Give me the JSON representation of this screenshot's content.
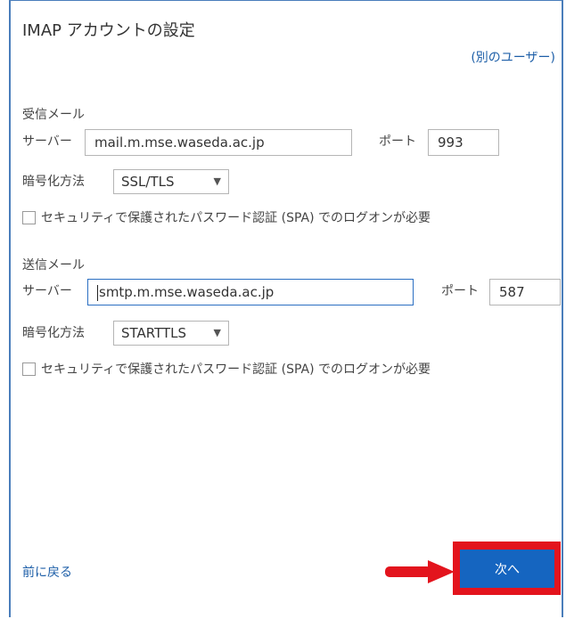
{
  "dialog": {
    "title": "IMAP アカウントの設定",
    "other_user_link": "(別のユーザー)"
  },
  "incoming": {
    "heading": "受信メール",
    "server_label": "サーバー",
    "server_value": "mail.m.mse.waseda.ac.jp",
    "port_label": "ポート",
    "port_value": "993",
    "encryption_label": "暗号化方法",
    "encryption_value": "SSL/TLS",
    "spa_label": "セキュリティで保護されたパスワード認証 (SPA) でのログオンが必要",
    "spa_checked": false
  },
  "outgoing": {
    "heading": "送信メール",
    "server_label": "サーバー",
    "server_value": "smtp.m.mse.waseda.ac.jp",
    "port_label": "ポート",
    "port_value": "587",
    "encryption_label": "暗号化方法",
    "encryption_value": "STARTTLS",
    "spa_label": "セキュリティで保護されたパスワード認証 (SPA) でのログオンが必要",
    "spa_checked": false
  },
  "footer": {
    "back_label": "前に戻る",
    "next_label": "次へ"
  },
  "colors": {
    "accent": "#1565c0",
    "highlight": "#e3141d",
    "link": "#1e5fa8"
  }
}
